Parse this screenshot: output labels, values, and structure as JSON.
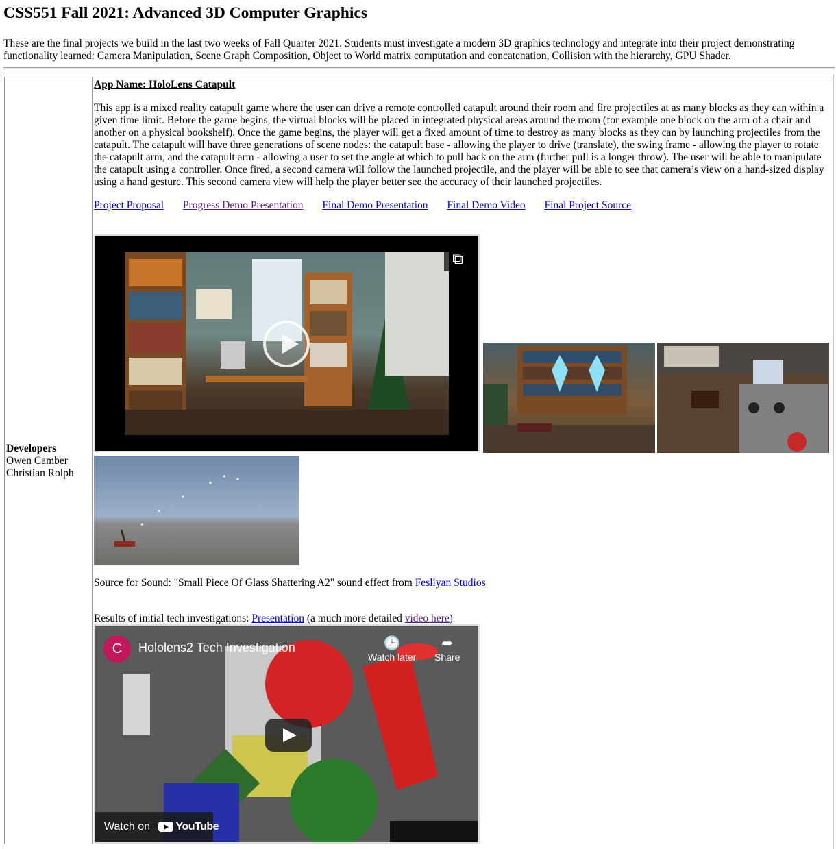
{
  "page": {
    "title": "CSS551 Fall 2021: Advanced 3D Computer Graphics",
    "intro": "These are the final projects we build in the last two weeks of Fall Quarter 2021. Students must investigate a modern 3D graphics technology and integrate into their project demonstrating functionality learned: Camera Manipulation, Scene Graph Composition, Object to World matrix computation and concatenation, Collision with the hierarchy, GPU Shader."
  },
  "developers": {
    "heading": "Developers",
    "names": [
      "Owen Camber",
      "Christian Rolph"
    ]
  },
  "project": {
    "app_name": "App Name: HoloLens Catapult",
    "description": "This app is a mixed reality catapult game where the user can drive a remote controlled catapult around their room and fire projectiles at as many blocks as they can within a given time limit. Before the game begins, the virtual blocks will be placed in integrated physical areas around the room (for example one block on the arm of a chair and another on a physical bookshelf). Once the game begins, the player will get a fixed amount of time to destroy as many blocks as they can by launching projectiles from the catapult. The catapult will have three generations of scene nodes: the catapult base - allowing the player to drive (translate), the swing frame - allowing the player to rotate the catapult arm, and the catapult arm - allowing a user to set the angle at which to pull back on the arm (further pull is a longer throw). The user will be able to manipulate the catapult using a controller. Once fired, a second camera will follow the launched projectile, and the player will be able to see that camera’s view on a hand-sized display using a hand gesture. This second camera view will help the player better see the accuracy of their launched projectiles.",
    "links": [
      {
        "label": "Project Proposal"
      },
      {
        "label": "Progress Demo Presentation"
      },
      {
        "label": "Final Demo Presentation"
      },
      {
        "label": "Final Demo Video"
      },
      {
        "label": "Final Project Source"
      }
    ],
    "video_icon": "expand-icon",
    "thumbnail_icons": [
      "play-icon"
    ],
    "sound_prefix": "Source for Sound: \"Small Piece Of Glass Shattering A2\" sound effect from ",
    "sound_link": "Fesliyan Studios",
    "results_prefix": "Results of initial tech investigations: ",
    "results_link": "Presentation",
    "results_middle": " (a much more detailed ",
    "results_video_link": "video here",
    "results_suffix": ")"
  },
  "youtube": {
    "avatar_letter": "C",
    "title": "Hololens2 Tech Investigation",
    "watch_later": "Watch later",
    "share": "Share",
    "watch_on": "Watch on",
    "brand": "YouTube"
  },
  "colors": {
    "link": "#0000ee",
    "visited_link": "#551a8b",
    "avatar": "#c2185b"
  }
}
